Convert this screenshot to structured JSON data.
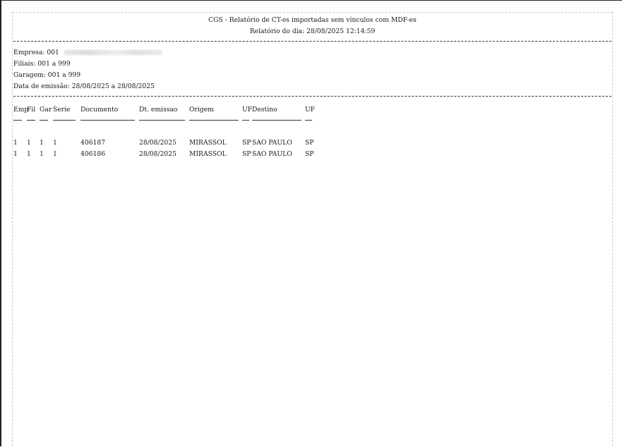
{
  "report": {
    "title": "CGS - Relatório de CT-es importadas sem vínculos com MDF-es",
    "subtitle": "Relatório do dia: 28/08/2025 12:14:59"
  },
  "filters": {
    "empresa": "Empresa: 001",
    "filiais": "Filiais: 001 a 999",
    "garagem": "Garagem: 001 a 999",
    "data_emissao": "Data de emissão: 28/08/2025 a 28/08/2025"
  },
  "table": {
    "headers": [
      "Emp",
      "Fil",
      "Gar",
      "Serie",
      "Documento",
      "Dt. emissao",
      "Origem",
      "UF",
      "Destino",
      "UF"
    ],
    "rows": [
      [
        "1",
        "1",
        "1",
        "1",
        "406187",
        "28/08/2025",
        "MIRASSOL",
        "SP",
        "SAO PAULO",
        "SP"
      ],
      [
        "1",
        "1",
        "1",
        "1",
        "406186",
        "28/08/2025",
        "MIRASSOL",
        "SP",
        "SAO PAULO",
        "SP"
      ]
    ]
  }
}
